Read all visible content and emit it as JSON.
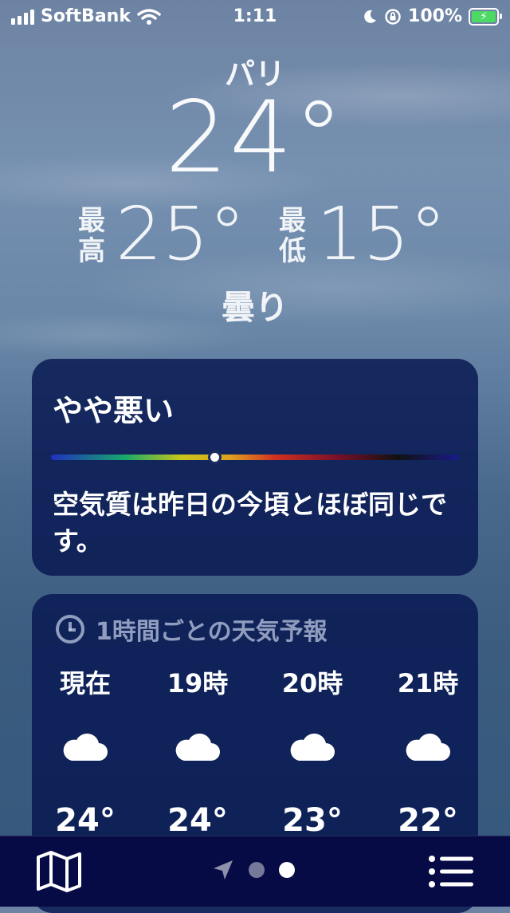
{
  "status_bar": {
    "carrier": "SoftBank",
    "time": "1:11",
    "battery": "100%"
  },
  "weather": {
    "city": "パリ",
    "temperature": "24°",
    "high_label": "最高",
    "high": "25°",
    "low_label": "最低",
    "low": "15°",
    "condition": "曇り"
  },
  "air_quality": {
    "title": "やや悪い",
    "level_fraction": 0.4,
    "description": "空気質は昨日の今頃とほぼ同じです。"
  },
  "hourly": {
    "title": "1時間ごとの天気予報",
    "items": [
      {
        "hour": "現在",
        "icon": "cloud-icon",
        "temp": "24°"
      },
      {
        "hour": "19時",
        "icon": "cloud-icon",
        "temp": "24°"
      },
      {
        "hour": "20時",
        "icon": "cloud-icon",
        "temp": "23°"
      },
      {
        "hour": "21時",
        "icon": "cloud-icon",
        "temp": "22°"
      }
    ]
  },
  "tabbar": {
    "icons": [
      "map-icon",
      "location-arrow-icon",
      "page-dot",
      "page-dot-active",
      "list-icon"
    ]
  },
  "colors": {
    "card_bg": "#061650",
    "tabbar_bg": "#070b45",
    "battery_fill": "#4cd964"
  }
}
